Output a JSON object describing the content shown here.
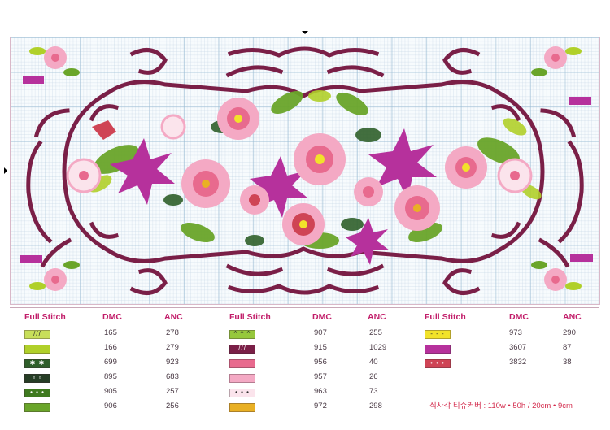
{
  "legend": {
    "columns": [
      {
        "headers": {
          "stitch": "Full Stitch",
          "dmc": "DMC",
          "anc": "ANC"
        },
        "rows": [
          {
            "dmc": "165",
            "anc": "278",
            "color": "#c8df5a",
            "symbol": "///"
          },
          {
            "dmc": "166",
            "anc": "279",
            "color": "#b0d02a",
            "symbol": ""
          },
          {
            "dmc": "699",
            "anc": "923",
            "color": "#2f5f2a",
            "symbol": "✱ ✱"
          },
          {
            "dmc": "895",
            "anc": "683",
            "color": "#263d25",
            "symbol": "▫ ▫"
          },
          {
            "dmc": "905",
            "anc": "257",
            "color": "#3f7a1f",
            "symbol": "• • •"
          },
          {
            "dmc": "906",
            "anc": "256",
            "color": "#6aa52a",
            "symbol": ""
          }
        ]
      },
      {
        "headers": {
          "stitch": "Full Stitch",
          "dmc": "DMC",
          "anc": "ANC"
        },
        "rows": [
          {
            "dmc": "907",
            "anc": "255",
            "color": "#96c83c",
            "symbol": "^ ^ ^"
          },
          {
            "dmc": "915",
            "anc": "1029",
            "color": "#7a1f47",
            "symbol": "///"
          },
          {
            "dmc": "956",
            "anc": "40",
            "color": "#e86a8e",
            "symbol": ""
          },
          {
            "dmc": "957",
            "anc": "26",
            "color": "#f4a9c4",
            "symbol": ""
          },
          {
            "dmc": "963",
            "anc": "73",
            "color": "#fbe4ec",
            "symbol": "• • •"
          },
          {
            "dmc": "972",
            "anc": "298",
            "color": "#e9b024",
            "symbol": ""
          }
        ]
      },
      {
        "headers": {
          "stitch": "Full Stitch",
          "dmc": "DMC",
          "anc": "ANC"
        },
        "rows": [
          {
            "dmc": "973",
            "anc": "290",
            "color": "#f2e22a",
            "symbol": "- - -"
          },
          {
            "dmc": "3607",
            "anc": "87",
            "color": "#b6319c",
            "symbol": ""
          },
          {
            "dmc": "3832",
            "anc": "38",
            "color": "#cf4455",
            "symbol": "• • •"
          }
        ]
      }
    ]
  },
  "size_note": "직사각 티슈커버 : 110w • 50h / 20cm • 9cm",
  "pattern_colors": {
    "border": "#7a1f47",
    "magenta": "#b6319c",
    "pink_light": "#f4a9c4",
    "pink_mid": "#e86a8e",
    "pink_pale": "#fbe4ec",
    "green_light": "#b0d02a",
    "green_mid": "#6aa52a",
    "green_dark": "#2f5f2a",
    "yellow": "#f2e22a",
    "orange": "#e9b024",
    "red": "#cf4455"
  }
}
